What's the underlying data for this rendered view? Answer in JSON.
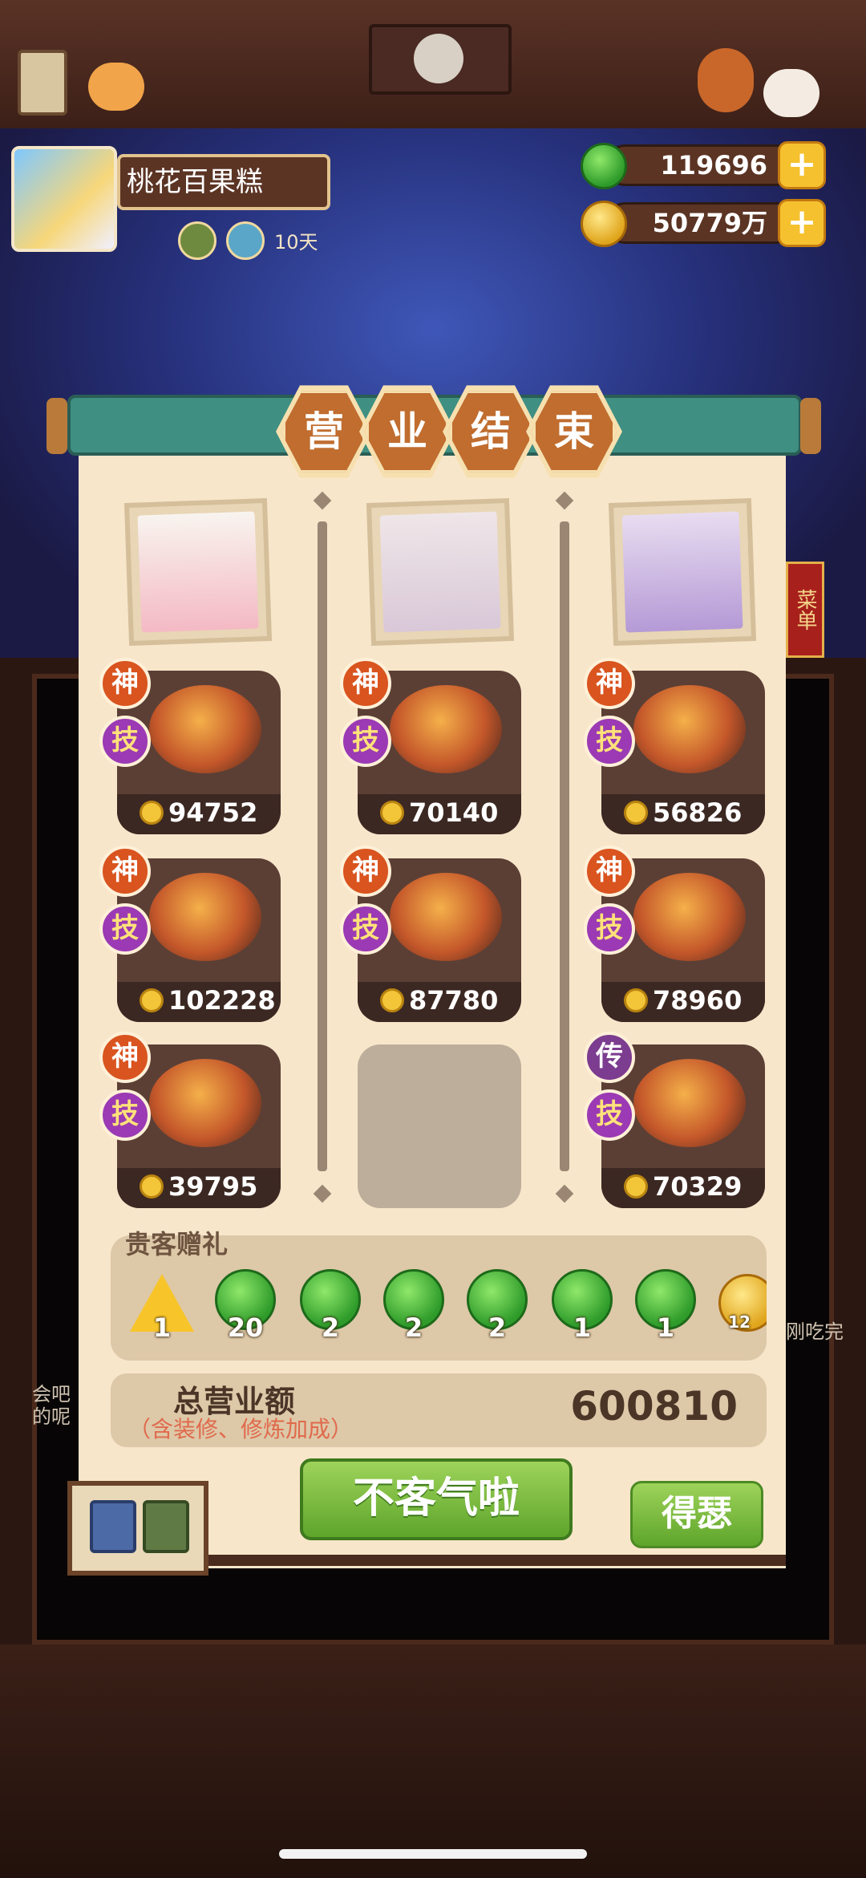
{
  "player": {
    "name": "桃花百果糕",
    "days": "10天"
  },
  "currency": {
    "jade": "119696",
    "coins": "50779万",
    "add_label": "+"
  },
  "banner": {
    "chars": [
      "营",
      "业",
      "结",
      "束"
    ]
  },
  "columns": [
    {
      "portrait": "hello-kitty",
      "dishes": [
        {
          "tag1": "神",
          "tag2": "技",
          "value": "94752"
        },
        {
          "tag1": "神",
          "tag2": "技",
          "value": "102228"
        },
        {
          "tag1": "神",
          "tag2": "技",
          "value": "39795"
        }
      ]
    },
    {
      "portrait": "cat-girl",
      "dishes": [
        {
          "tag1": "神",
          "tag2": "技",
          "value": "70140"
        },
        {
          "tag1": "神",
          "tag2": "技",
          "value": "87780"
        }
      ]
    },
    {
      "portrait": "kuromi",
      "dishes": [
        {
          "tag1": "神",
          "tag2": "技",
          "value": "56826"
        },
        {
          "tag1": "神",
          "tag2": "技",
          "value": "78960"
        },
        {
          "tag1": "传",
          "tag2": "技",
          "value": "70329"
        }
      ]
    }
  ],
  "gifts": {
    "title": "贵客赠礼",
    "items": [
      {
        "type": "star",
        "count": "1"
      },
      {
        "type": "jade",
        "count": "20"
      },
      {
        "type": "jade",
        "count": "2"
      },
      {
        "type": "jade",
        "count": "2"
      },
      {
        "type": "jade",
        "count": "2"
      },
      {
        "type": "jade",
        "count": "1"
      },
      {
        "type": "jade",
        "count": "1"
      },
      {
        "type": "coin",
        "count": "12"
      }
    ]
  },
  "total": {
    "label": "总营业额",
    "sublabel": "（含装修、修炼加成）",
    "value": "600810"
  },
  "buttons": {
    "main": "不客气啦",
    "side": "得瑟"
  },
  "background": {
    "left_text_1": "会吧",
    "left_text_2": "的呢",
    "right_text": "刚吃完",
    "menu_sign": "菜单"
  }
}
